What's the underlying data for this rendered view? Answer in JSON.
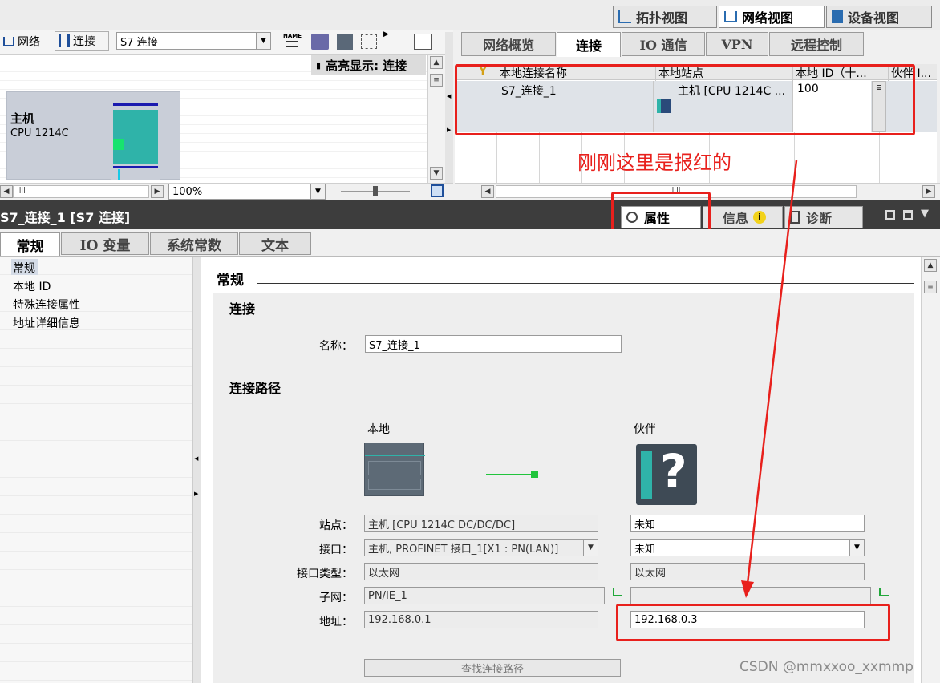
{
  "view_tabs": {
    "topology": "拓扑视图",
    "network": "网络视图",
    "device": "设备视图"
  },
  "net_toolbar": {
    "network_label": "网络",
    "connection_label": "连接",
    "connection_type": "S7 连接",
    "name_icon_text": "NAME"
  },
  "highlight": "高亮显示: 连接",
  "device": {
    "name": "主机",
    "cpu": "CPU 1214C"
  },
  "zoom": "100%",
  "overview_tabs": [
    "网络概览",
    "连接",
    "IO 通信",
    "VPN",
    "远程控制"
  ],
  "conn_table": {
    "headers": [
      "本地连接名称",
      "本地站点",
      "本地 ID（十...",
      "伙伴 I..."
    ],
    "rows": [
      {
        "name": "S7_连接_1",
        "station": "主机 [CPU 1214C ...",
        "id": "100"
      }
    ]
  },
  "annotation": "刚刚这里是报红的",
  "inspector": {
    "title": "S7_连接_1 [S7 连接]",
    "right_tabs": {
      "properties": "属性",
      "info": "信息",
      "diagnostics": "诊断"
    },
    "tabs": [
      "常规",
      "IO 变量",
      "系统常数",
      "文本"
    ],
    "nav": [
      "常规",
      "本地 ID",
      "特殊连接属性",
      "地址详细信息"
    ],
    "section_title": "常规",
    "group_title": "连接",
    "name_label": "名称：",
    "name_value": "S7_连接_1",
    "path_title": "连接路径",
    "local_label": "本地",
    "partner_label": "伙伴",
    "fields": {
      "station": {
        "label": "站点：",
        "local": "主机 [CPU 1214C DC/DC/DC]",
        "partner": "未知"
      },
      "interface": {
        "label": "接口：",
        "local": "主机, PROFINET 接口_1[X1 : PN(LAN)]",
        "partner": "未知"
      },
      "iftype": {
        "label": "接口类型：",
        "local": "以太网",
        "partner": "以太网"
      },
      "subnet": {
        "label": "子网：",
        "local": "PN/IE_1",
        "partner": ""
      },
      "address": {
        "label": "地址：",
        "local": "192.168.0.1",
        "partner": "192.168.0.3"
      }
    },
    "find_path": "查找连接路径"
  },
  "watermark": "CSDN @mmxxoo_xxmmp",
  "colors": {
    "accent_red": "#e8201c",
    "teal": "#2fb3a9",
    "dark_band": "#3d3d3d",
    "panel": "#eeeeee"
  }
}
